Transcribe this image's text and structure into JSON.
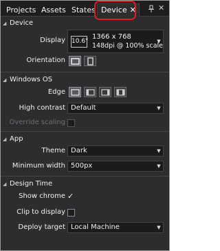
{
  "tabs": [
    {
      "label": "Projects"
    },
    {
      "label": "Assets"
    },
    {
      "label": "States"
    },
    {
      "label": "Device",
      "close": "✕"
    }
  ],
  "window": {
    "close": "✕"
  },
  "device": {
    "title": "Device",
    "display_label": "Display",
    "display_size": "10.6\"",
    "display_resolution": "1366 x 768",
    "display_dpi": "148dpi @ 100% scale",
    "orientation_label": "Orientation"
  },
  "windows_os": {
    "title": "Windows OS",
    "edge_label": "Edge",
    "high_contrast_label": "High contrast",
    "high_contrast_value": "Default",
    "override_scaling_label": "Override scaling"
  },
  "app": {
    "title": "App",
    "theme_label": "Theme",
    "theme_value": "Dark",
    "min_width_label": "Minimum width",
    "min_width_value": "500px"
  },
  "design_time": {
    "title": "Design Time",
    "show_chrome_label": "Show chrome",
    "show_chrome_check": "✓",
    "clip_to_display_label": "Clip to display",
    "deploy_target_label": "Deploy target",
    "deploy_target_value": "Local Machine"
  },
  "colors": {
    "panel_bg": "#2d2d30",
    "field_bg": "#1b1b1c",
    "highlight": "#e21c1c"
  }
}
